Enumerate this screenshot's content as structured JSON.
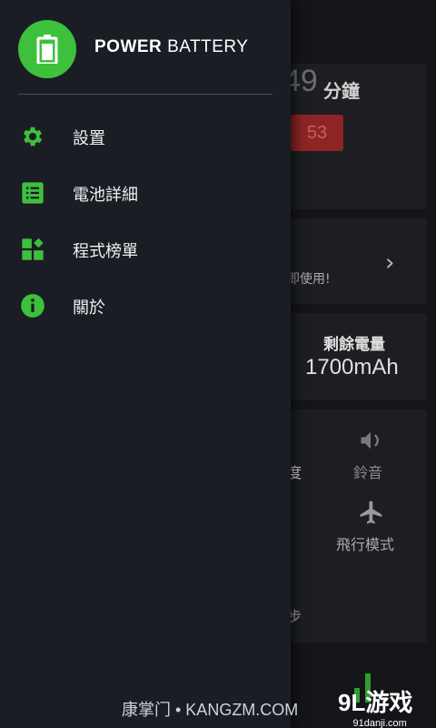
{
  "app": {
    "title_bold": "POWER",
    "title_rest": "BATTERY",
    "accent_color": "#3dc13c",
    "logo_icon": "battery-icon"
  },
  "menu": [
    {
      "label": "設置",
      "icon": "gear-icon"
    },
    {
      "label": "電池詳細",
      "icon": "list-icon"
    },
    {
      "label": "程式榜單",
      "icon": "widgets-icon"
    },
    {
      "label": "關於",
      "icon": "info-icon"
    }
  ],
  "background": {
    "time_partial": "49",
    "minutes_label": "分鐘",
    "red_value": "53",
    "use_text": "即使用!",
    "remaining_label": "剩餘電量",
    "remaining_value": "1700mAh",
    "brightness_partial": "度",
    "ringtone_label": "鈴音",
    "flight_label": "飛行模式",
    "sync_partial": "步"
  },
  "watermarks": {
    "left": "康掌门 • KANGZM.COM",
    "right_big": "9L游戏",
    "right_small": "91danji.com"
  }
}
